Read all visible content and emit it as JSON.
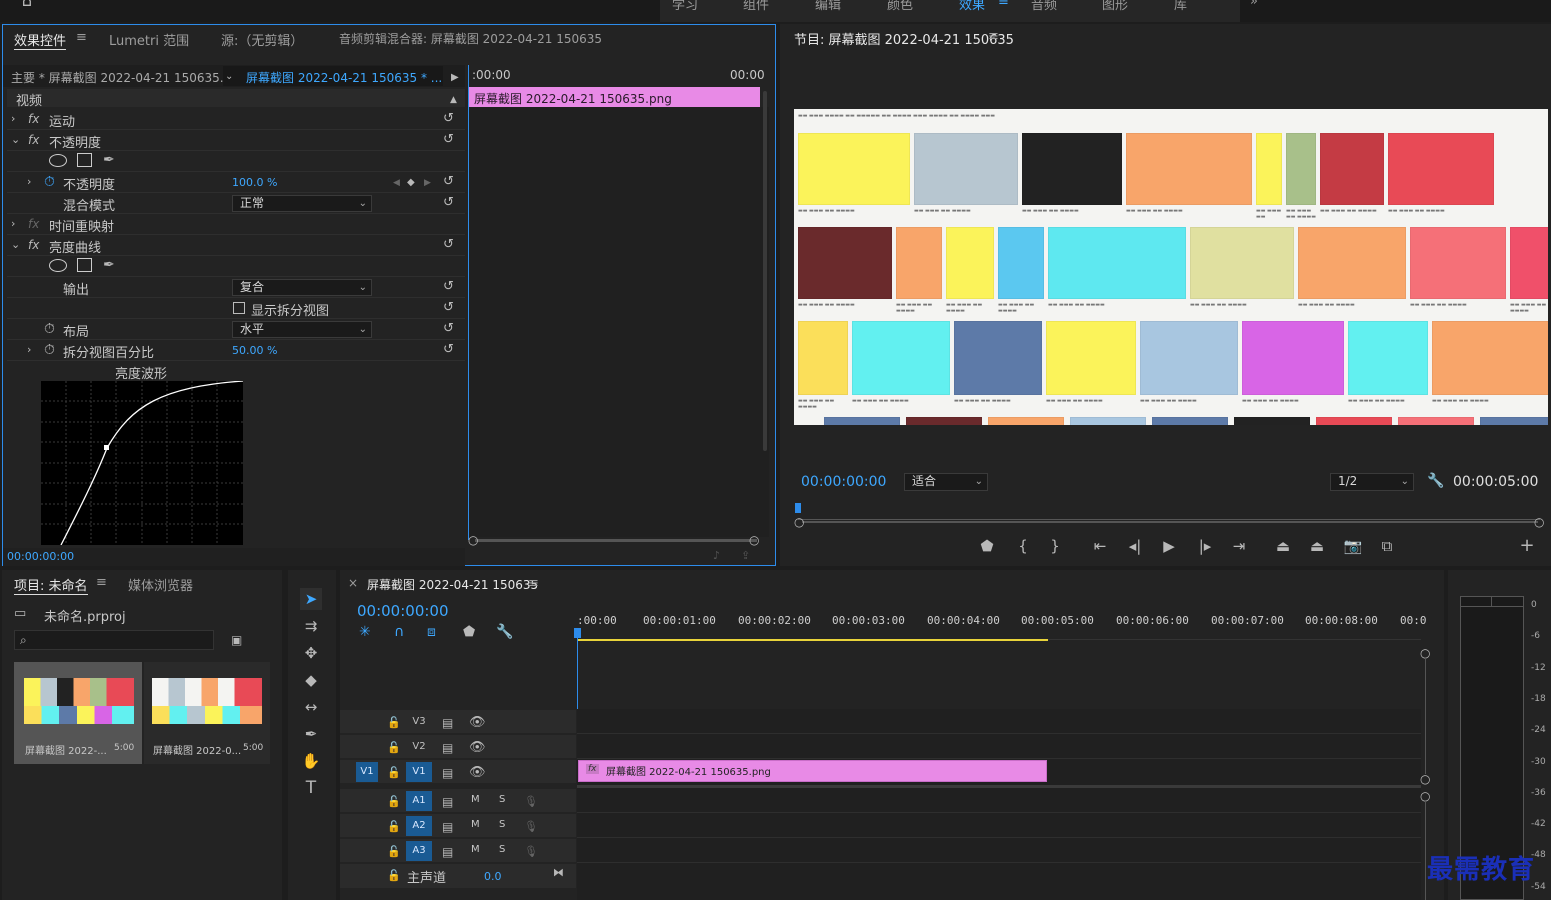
{
  "workspace_tabs": [
    "学习",
    "组件",
    "编辑",
    "颜色",
    "效果",
    "音频",
    "图形",
    "库"
  ],
  "effect_panel": {
    "tabs": [
      "效果控件",
      "Lumetri 范围",
      "源:（无剪辑）",
      "音频剪辑混合器: 屏幕截图 2022-04-21 150635"
    ],
    "menu_glyph": "≡",
    "master_label": "主要 * 屏幕截图 2022-04-21 150635...",
    "clip_label": "屏幕截图 2022-04-21 150635 * ...",
    "time_start": ":00:00",
    "time_end": "00:00",
    "section_video": "视频",
    "clip_bar_label": "屏幕截图 2022-04-21  150635.png",
    "fx_motion": "运动",
    "fx_opacity": "不透明度",
    "opacity_param": "不透明度",
    "opacity_value": "100.0 %",
    "blend_mode_label": "混合模式",
    "blend_mode_value": "正常",
    "fx_time_remap": "时间重映射",
    "fx_luma_curve": "亮度曲线",
    "output_label": "输出",
    "output_value": "复合",
    "split_view_label": "显示拆分视图",
    "layout_label": "布局",
    "layout_value": "水平",
    "split_pct_label": "拆分视图百分比",
    "split_pct_value": "50.00 %",
    "waveform_label": "亮度波形",
    "timecode": "00:00:00:00"
  },
  "program_monitor": {
    "title": "节目: 屏幕截图 2022-04-21 150635",
    "menu_glyph": "≡",
    "timecode": "00:00:00:00",
    "fit_value": "适合",
    "quality_value": "1/2",
    "duration": "00:00:05:00",
    "preview_tiles": [
      "#fbf35a",
      "#b7c6d0",
      "#222222",
      "#f8a56a",
      "#fbf35a",
      "#a8c08a",
      "#c43b44",
      "#e84a56",
      "#6a2a2c",
      "#f8a56a",
      "#fbf35a",
      "#5bc8f0",
      "#5ee8f0",
      "#e0e0a0",
      "#f8a56a",
      "#f57078",
      "#f0506a",
      "#fbdf5a",
      "#62f0f0",
      "#5d7aa8",
      "#fbf35a",
      "#a8c6e0",
      "#d865e6",
      "#62f0f0",
      "#f8a56a"
    ]
  },
  "project_panel": {
    "tabs": [
      "项目: 未命名",
      "媒体浏览器"
    ],
    "menu_glyph": "≡",
    "project_file": "未命名.prproj",
    "search_placeholder": "",
    "items": [
      {
        "name": "屏幕截图 2022-...",
        "duration": "5:00"
      },
      {
        "name": "屏幕截图 2022-0...",
        "duration": "5:00"
      }
    ]
  },
  "timeline": {
    "title": "屏幕截图 2022-04-21 150635",
    "menu_glyph": "≡",
    "close_glyph": "×",
    "timecode": "00:00:00:00",
    "ruler": [
      ":00:00",
      "00:00:01:00",
      "00:00:02:00",
      "00:00:03:00",
      "00:00:04:00",
      "00:00:05:00",
      "00:00:06:00",
      "00:00:07:00",
      "00:00:08:00",
      "00:0"
    ],
    "video_tracks": [
      "V3",
      "V2",
      "V1"
    ],
    "source_v": "V1",
    "audio_tracks": [
      "A1",
      "A2",
      "A3"
    ],
    "mute_label": "M",
    "solo_label": "S",
    "master_label": "主声道",
    "master_value": "0.0",
    "clip_label": "屏幕截图 2022-04-21  150635.png",
    "fx_badge": "fx"
  },
  "audio_meter": {
    "scale": [
      "0",
      "-6",
      "-12",
      "-18",
      "-24",
      "-30",
      "-36",
      "-42",
      "-48",
      "-54"
    ]
  },
  "watermark": "最需教育"
}
